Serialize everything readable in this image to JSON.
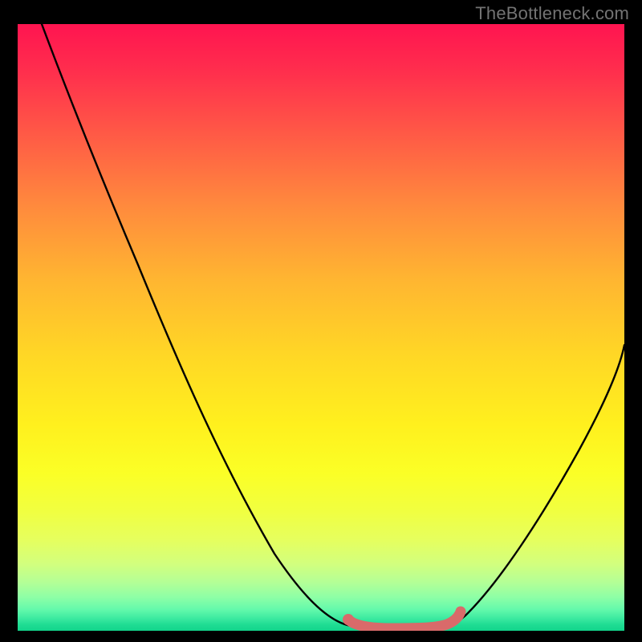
{
  "attribution": "TheBottleneck.com",
  "chart_data": {
    "type": "line",
    "title": "",
    "xlabel": "",
    "ylabel": "",
    "xlim": [
      0,
      100
    ],
    "ylim": [
      0,
      100
    ],
    "series": [
      {
        "name": "bottleneck-curve",
        "x": [
          4,
          12,
          20,
          28,
          35,
          42,
          48,
          52,
          55,
          58,
          62,
          66,
          70,
          74,
          80,
          88,
          96,
          100
        ],
        "y": [
          100,
          84,
          67,
          50,
          35,
          21,
          10,
          4,
          1,
          0,
          0,
          0,
          0,
          1,
          6,
          18,
          36,
          48
        ]
      },
      {
        "name": "optimal-range-marker",
        "x": [
          55,
          58,
          62,
          66,
          70,
          72
        ],
        "y": [
          1.5,
          0.5,
          0.5,
          0.5,
          0.8,
          2
        ]
      }
    ],
    "gradient_stops": [
      {
        "pos": 0,
        "color": "#ff1450"
      },
      {
        "pos": 50,
        "color": "#ffd028"
      },
      {
        "pos": 100,
        "color": "#12d48b"
      }
    ]
  }
}
